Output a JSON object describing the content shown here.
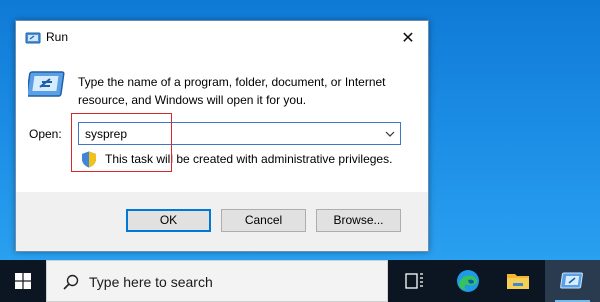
{
  "dialog": {
    "title": "Run",
    "close_glyph": "✕",
    "description": "Type the name of a program, folder, document, or Internet resource, and Windows will open it for you.",
    "open_label": "Open:",
    "open_value": "sysprep",
    "admin_note": "This task will be created with administrative privileges.",
    "buttons": {
      "ok": "OK",
      "cancel": "Cancel",
      "browse": "Browse..."
    },
    "icons": {
      "title": "run-icon",
      "big": "run-icon",
      "dropdown": "chevron-down-icon",
      "shield": "uac-shield-icon"
    },
    "highlight_color": "#d62a2a"
  },
  "taskbar": {
    "search_placeholder": "Type here to search",
    "items": [
      "start-icon",
      "task-view-icon",
      "edge-icon",
      "file-explorer-icon",
      "run-icon"
    ]
  },
  "colors": {
    "desktop": "#1a86d8",
    "taskbar": "#0c1622",
    "accent": "#0078d7"
  }
}
